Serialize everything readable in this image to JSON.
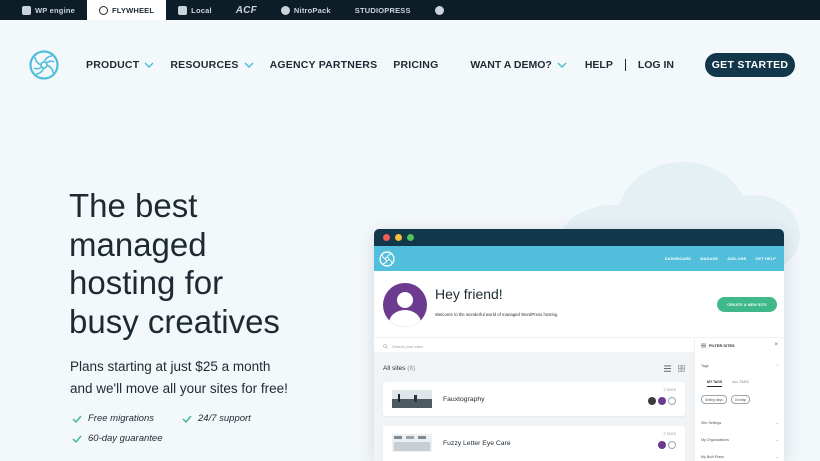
{
  "brand_bar": {
    "brands": [
      "WP engine",
      "FLYWHEEL",
      "Local",
      "ACF",
      "NitroPack",
      "STUDIOPRESS"
    ]
  },
  "nav": {
    "links": [
      {
        "label": "PRODUCT",
        "dropdown": true
      },
      {
        "label": "RESOURCES",
        "dropdown": true
      },
      {
        "label": "AGENCY PARTNERS",
        "dropdown": false
      },
      {
        "label": "PRICING",
        "dropdown": false
      }
    ],
    "demo_label": "WANT A DEMO?",
    "help_label": "HELP",
    "login_label": "LOG IN",
    "cta_label": "GET STARTED"
  },
  "hero": {
    "title_lines": [
      "The best",
      "managed",
      "hosting for",
      "busy creatives"
    ],
    "subtitle_lines": [
      "Plans starting at just $25 a month",
      "and we'll move all your sites for free!"
    ],
    "features": [
      "Free migrations",
      "24/7 support",
      "60-day guarantee"
    ]
  },
  "app": {
    "nav_links": [
      "DASHBOARD",
      "MANAGE",
      "ADD-ONS",
      "GET HELP"
    ],
    "greeting": "Hey friend!",
    "welcome_text": "Welcome to the wonderful world of managed WordPress hosting",
    "create_button": "CREATE A NEW SITE",
    "search_placeholder": "Search your sites",
    "all_sites_label": "All sites",
    "all_sites_count": "(8)",
    "sites": [
      {
        "name": "Fauxtography",
        "tags": "2 TAGS"
      },
      {
        "name": "Fuzzy Letter Eye Care",
        "tags": "2 TAGS"
      }
    ],
    "filter": {
      "title": "FILTER SITES",
      "tags_label": "Tags",
      "tab_my": "MY TAGS",
      "tab_all": "ALL TAGS",
      "chips": [
        "Selling days",
        "Overlap"
      ],
      "rows": [
        "Site Settings",
        "My Organizations",
        "My Built Plans"
      ]
    }
  },
  "colors": {
    "navy": "#12364a",
    "accent_teal": "#51bfdb",
    "green": "#3fb98a",
    "purple": "#6c3a8e"
  }
}
